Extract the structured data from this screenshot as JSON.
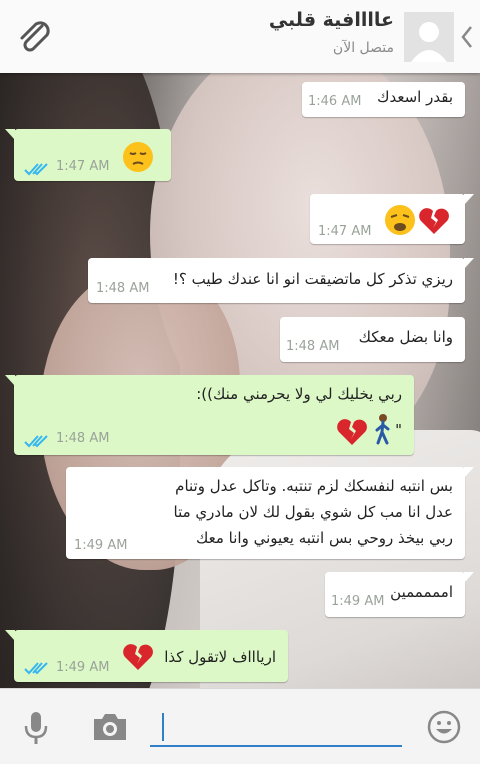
{
  "header": {
    "contact_name": "عاااافية قلبي",
    "status": "متصل الآن"
  },
  "messages": [
    {
      "text": "بقدر اسعدك",
      "time": "1:46 AM",
      "direction": "incoming"
    },
    {
      "text": "",
      "time": "1:47 AM",
      "direction": "outgoing",
      "emoji": [
        "pensive-face"
      ],
      "ticks": "read"
    },
    {
      "text": "",
      "time": "1:47 AM",
      "direction": "incoming",
      "emoji": [
        "weary-face",
        "broken-heart"
      ]
    },
    {
      "text": "ريزي تذكر كل ماتضيقت انو انا عندك طيب ؟!",
      "time": "1:48 AM",
      "direction": "incoming"
    },
    {
      "text": "وانا بضل معكك",
      "time": "1:48 AM",
      "direction": "incoming"
    },
    {
      "text": "ربي يخليك لي ولا يحرمني منك)):",
      "line2": "\"",
      "time": "1:48 AM",
      "direction": "outgoing",
      "emoji": [
        "broken-heart",
        "walking-person"
      ],
      "ticks": "read"
    },
    {
      "lines": [
        "بس انتبه لنفسكك لزم تنتبه. وتاكل عدل وتنام",
        "عدل انا مب كل شوي بقول لك لان مادري متا",
        "ربي بيخذ روحي بس انتبه يعيوني وانا معك"
      ],
      "time": "1:49 AM",
      "direction": "incoming"
    },
    {
      "text": "امممممين",
      "time": "1:49 AM",
      "direction": "incoming"
    },
    {
      "text": "ارياااف لاتقول كذا",
      "time": "1:49 AM",
      "direction": "outgoing",
      "emoji": [
        "broken-heart"
      ],
      "ticks": "read"
    }
  ],
  "colors": {
    "incoming_bubble": "#ffffff",
    "outgoing_bubble": "#dcf8c6",
    "read_ticks": "#34b7f1",
    "input_underline": "#2f80c9"
  },
  "input": {
    "value": "",
    "icons": [
      "mic-icon",
      "camera-icon",
      "emoji-icon"
    ]
  }
}
